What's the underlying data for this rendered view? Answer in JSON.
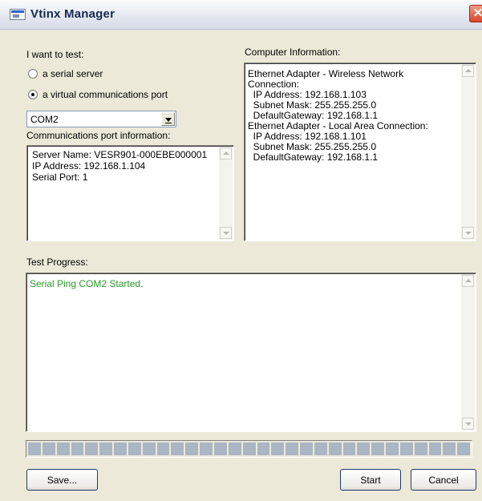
{
  "window": {
    "title": "Vtinx Manager",
    "close_glyph": "✕"
  },
  "test_target": {
    "heading": "I want to test:",
    "options": [
      {
        "label": "a serial server",
        "selected": false
      },
      {
        "label": "a virtual communications port",
        "selected": true
      }
    ],
    "port_select": {
      "value": "COM2"
    }
  },
  "port_info": {
    "heading": "Communications  port information:",
    "lines": [
      "Server Name: VESR901-000EBE000001",
      "IP Address: 192.168.1.104",
      "Serial Port: 1"
    ]
  },
  "computer_info": {
    "heading": "Computer Information:",
    "lines": [
      "Ethernet Adapter - Wireless Network",
      "Connection:",
      "  IP Address: 192.168.1.103",
      "  Subnet Mask: 255.255.255.0",
      "  DefaultGateway: 192.168.1.1",
      "Ethernet Adapter - Local Area Connection:",
      "  IP Address: 192.168.1.101",
      "  Subnet Mask: 255.255.255.0",
      "  DefaultGateway: 192.168.1.1"
    ]
  },
  "test_progress": {
    "heading": "Test Progress:",
    "log": [
      "Serial Ping COM2 Started."
    ],
    "log_color": "#2a9a2a",
    "progress_fraction": 0
  },
  "buttons": {
    "save": "Save...",
    "start": "Start",
    "cancel": "Cancel"
  },
  "icons": {
    "app": "app-window-icon",
    "dropdown": "chevron-down-icon",
    "scroll_up": "scroll-up-arrow-icon",
    "scroll_down": "scroll-down-arrow-icon"
  }
}
